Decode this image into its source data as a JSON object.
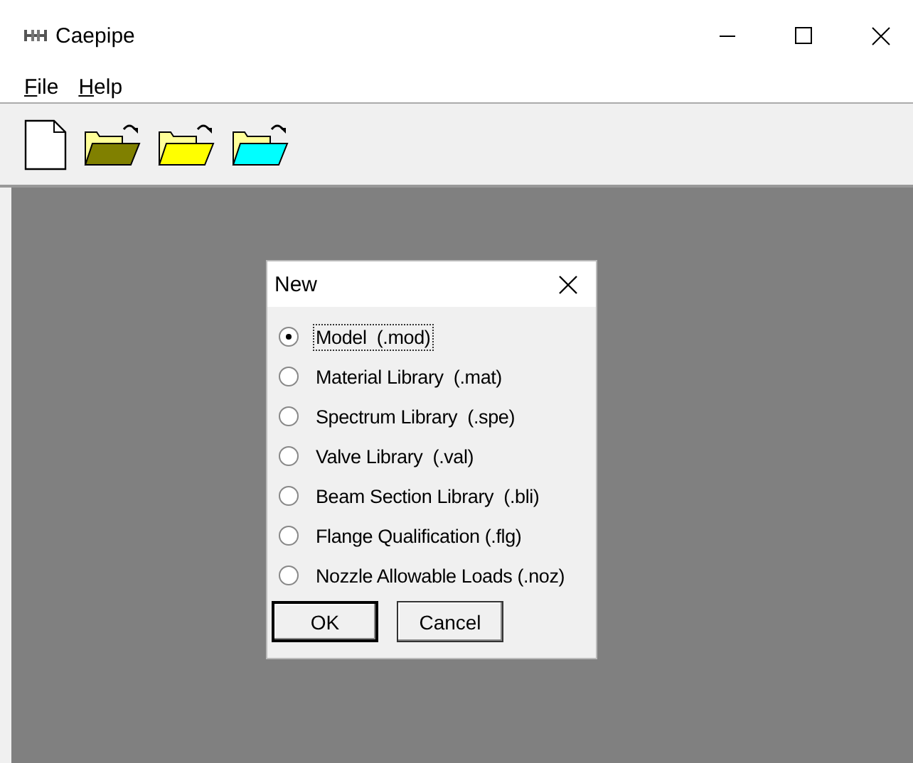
{
  "window": {
    "title": "Caepipe"
  },
  "menu": [
    "File",
    "Help"
  ],
  "toolbar": [
    {
      "kind": "document"
    },
    {
      "kind": "folder",
      "color": "#808000"
    },
    {
      "kind": "folder",
      "color": "#ffff00"
    },
    {
      "kind": "folder",
      "color": "#00ffff"
    }
  ],
  "dialog": {
    "title": "New",
    "options": [
      {
        "label": "Model  (.mod)",
        "selected": true
      },
      {
        "label": "Material Library  (.mat)",
        "selected": false
      },
      {
        "label": "Spectrum Library  (.spe)",
        "selected": false
      },
      {
        "label": "Valve Library  (.val)",
        "selected": false
      },
      {
        "label": "Beam Section Library  (.bli)",
        "selected": false
      },
      {
        "label": "Flange Qualification (.flg)",
        "selected": false
      },
      {
        "label": "Nozzle Allowable Loads (.noz)",
        "selected": false
      }
    ],
    "buttons": [
      "OK",
      "Cancel"
    ]
  }
}
